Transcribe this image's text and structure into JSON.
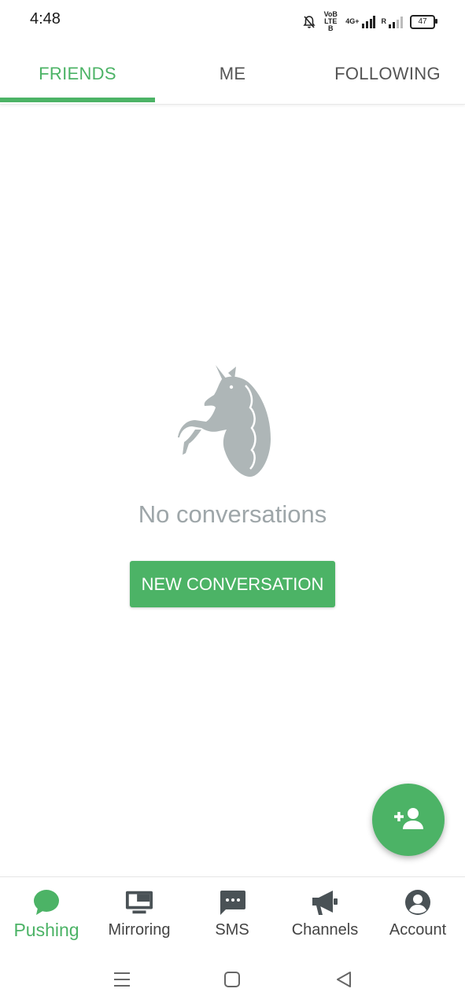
{
  "status_bar": {
    "time": "4:48",
    "network_label_1": "VoB LTE B",
    "network_label_2": "4G+",
    "roaming_label": "R",
    "battery": "47"
  },
  "tabs": [
    {
      "label": "FRIENDS",
      "active": true
    },
    {
      "label": "ME",
      "active": false
    },
    {
      "label": "FOLLOWING",
      "active": false
    }
  ],
  "empty_state": {
    "illustration": "unicorn-illustration",
    "message": "No conversations",
    "button_label": "NEW CONVERSATION"
  },
  "fab": {
    "icon": "add-person-icon"
  },
  "bottom_nav": [
    {
      "label": "Pushing",
      "icon": "chat-bubble-icon",
      "active": true
    },
    {
      "label": "Mirroring",
      "icon": "monitor-icon",
      "active": false
    },
    {
      "label": "SMS",
      "icon": "sms-icon",
      "active": false
    },
    {
      "label": "Channels",
      "icon": "megaphone-icon",
      "active": false
    },
    {
      "label": "Account",
      "icon": "account-circle-icon",
      "active": false
    }
  ],
  "colors": {
    "accent": "#4cb366",
    "muted_text": "#9ea6a9",
    "icon_dark": "#4a5256"
  }
}
